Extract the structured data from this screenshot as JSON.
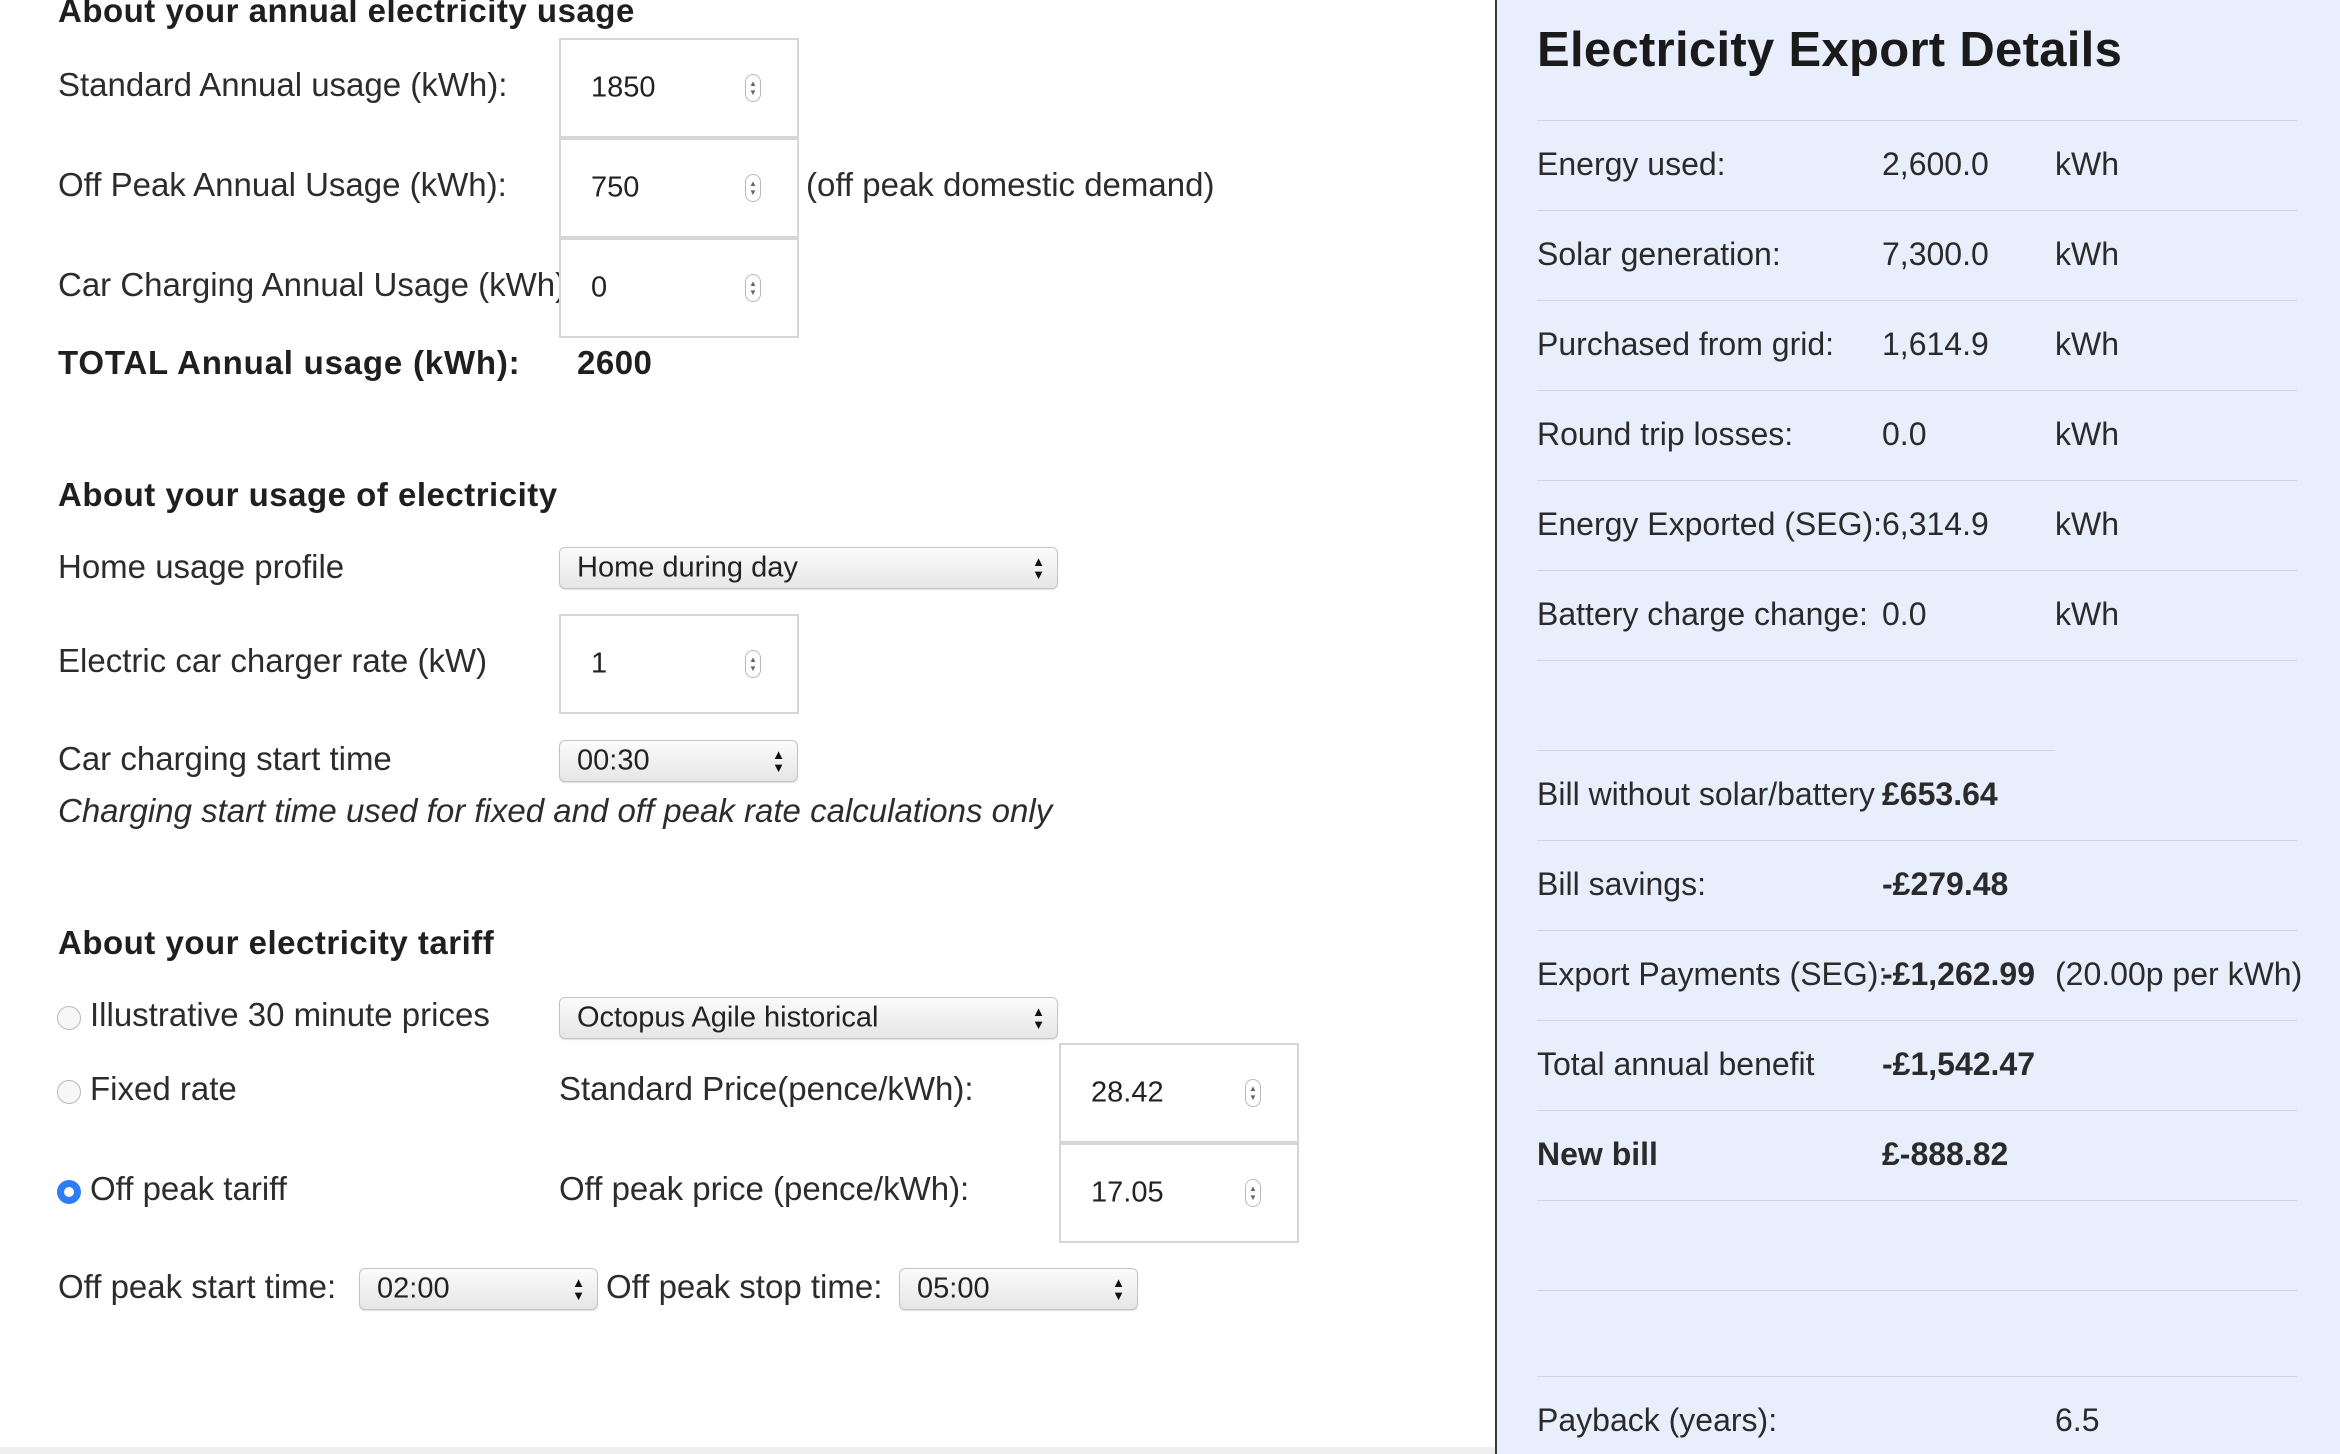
{
  "usage": {
    "heading": "About your annual electricity usage",
    "standard_label": "Standard Annual usage (kWh):",
    "standard_value": "1850",
    "offpeak_label": "Off Peak Annual Usage (kWh):",
    "offpeak_value": "750",
    "offpeak_note": "(off peak domestic demand)",
    "car_label": "Car Charging Annual Usage (kWh):",
    "car_value": "0",
    "total_label": "TOTAL Annual usage (kWh):",
    "total_value": "2600"
  },
  "profile": {
    "heading": "About your usage of electricity",
    "home_label": "Home usage profile",
    "home_value": "Home during day",
    "charger_label": "Electric car charger rate (kW)",
    "charger_value": "1",
    "start_label": "Car charging start time",
    "start_value": "00:30",
    "note": "Charging start time used for fixed and off peak rate calculations only"
  },
  "tariff": {
    "heading": "About your electricity tariff",
    "options": [
      {
        "label": "Illustrative 30 minute prices",
        "checked": false
      },
      {
        "label": "Fixed rate",
        "checked": false
      },
      {
        "label": "Off peak tariff",
        "checked": true
      }
    ],
    "agile_value": "Octopus Agile historical",
    "std_price_label": "Standard Price(pence/kWh):",
    "std_price_value": "28.42",
    "offpeak_price_label": "Off peak price (pence/kWh):",
    "offpeak_price_value": "17.05",
    "offpeak_start_label": "Off peak start time:",
    "offpeak_start_value": "02:00",
    "offpeak_stop_label": "Off peak stop time:",
    "offpeak_stop_value": "05:00"
  },
  "export": {
    "title": "Electricity Export Details",
    "energy_rows": [
      {
        "label": "Energy used:",
        "value": "2,600.0",
        "unit": "kWh"
      },
      {
        "label": "Solar generation:",
        "value": "7,300.0",
        "unit": "kWh"
      },
      {
        "label": "Purchased from grid:",
        "value": "1,614.9",
        "unit": "kWh"
      },
      {
        "label": "Round trip losses:",
        "value": "0.0",
        "unit": "kWh"
      },
      {
        "label": "Energy Exported (SEG):",
        "value": "6,314.9",
        "unit": "kWh"
      },
      {
        "label": "Battery charge change:",
        "value": "0.0",
        "unit": "kWh"
      }
    ],
    "bill_rows": [
      {
        "label": "Bill without solar/battery",
        "value": "£653.64",
        "note": ""
      },
      {
        "label": "Bill savings:",
        "value": "-£279.48",
        "note": ""
      },
      {
        "label": "Export Payments (SEG):",
        "value": "-£1,262.99",
        "note": "(20.00p per kWh)"
      },
      {
        "label": "Total annual benefit",
        "value": "-£1,542.47",
        "note": ""
      },
      {
        "label": "New bill",
        "value": "£-888.82",
        "note": ""
      }
    ],
    "payback_label": "Payback (years):",
    "payback_value": "6.5"
  }
}
